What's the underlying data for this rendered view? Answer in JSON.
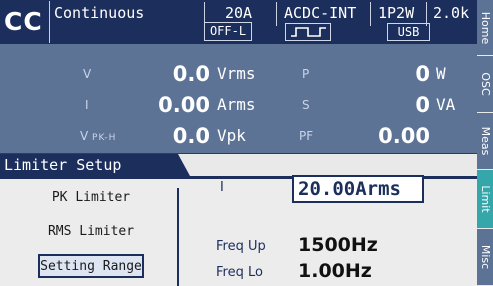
{
  "status": {
    "mode": "CC",
    "operation": "Continuous",
    "range": "20A",
    "coupling": "ACDC-INT",
    "wiring": "1P2W",
    "extra": "2.0k",
    "output_state": "OFF-L",
    "waveform_icon": "square-wave-icon",
    "interface": "USB"
  },
  "measurements": {
    "v": {
      "label": "V",
      "value": "0.0",
      "unit": "Vrms"
    },
    "i": {
      "label": "I",
      "value": "0.00",
      "unit": "Arms"
    },
    "vpk": {
      "label": "V",
      "label_sub": "PK-H",
      "value": "0.0",
      "unit": "Vpk"
    },
    "p": {
      "label": "P",
      "value": "0",
      "unit": "W"
    },
    "s": {
      "label": "S",
      "value": "0",
      "unit": "VA"
    },
    "pf": {
      "label": "PF",
      "value": "0.00"
    }
  },
  "limiter": {
    "title": "Limiter Setup",
    "menu": [
      "PK Limiter",
      "RMS Limiter",
      "Setting Range"
    ],
    "selected_index": 2,
    "i_label": "I",
    "i_value": "20.00Arms",
    "freq_up_label": "Freq Up",
    "freq_up_value": "1500Hz",
    "freq_lo_label": "Freq Lo",
    "freq_lo_value": "1.00Hz"
  },
  "tabs": [
    {
      "label": "Home",
      "active": false
    },
    {
      "label": "OSC",
      "active": false
    },
    {
      "label": "Meas",
      "active": false
    },
    {
      "label": "Limit",
      "active": true
    },
    {
      "label": "Misc",
      "active": false
    }
  ],
  "colors": {
    "header": "#1c2e5c",
    "measurement_bg": "#5c7396",
    "panel_bg": "#ececec",
    "active_tab": "#35a7aa"
  }
}
